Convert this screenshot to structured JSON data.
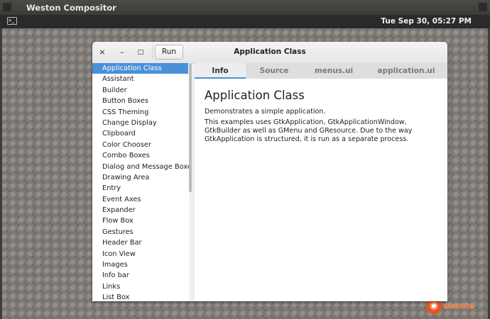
{
  "outer_window": {
    "title": "Weston Compositor"
  },
  "panel": {
    "terminal_icon_glyph": ">_",
    "clock": "Tue Sep 30, 05:27 PM"
  },
  "watermark": {
    "text": "ubuntu"
  },
  "app_window": {
    "title": "Application Class",
    "controls": {
      "close": "×",
      "minimize": "–",
      "maximize": "□"
    },
    "run_label": "Run"
  },
  "sidebar": {
    "selected_index": 0,
    "items": [
      "Application Class",
      "Assistant",
      "Builder",
      "Button Boxes",
      "CSS Theming",
      "Change Display",
      "Clipboard",
      "Color Chooser",
      "Combo Boxes",
      "Dialog and Message Boxes",
      "Drawing Area",
      "Entry",
      "Event Axes",
      "Expander",
      "Flow Box",
      "Gestures",
      "Header Bar",
      "Icon View",
      "Images",
      "Info bar",
      "Links",
      "List Box"
    ]
  },
  "tabs": [
    {
      "label": "Info",
      "active": true
    },
    {
      "label": "Source",
      "active": false
    },
    {
      "label": "menus.ui",
      "active": false
    },
    {
      "label": "application.ui",
      "active": false
    }
  ],
  "content": {
    "heading": "Application Class",
    "summary": "Demonstrates a simple application.",
    "description": "This examples uses GtkApplication, GtkApplicationWindow, GtkBuilder as well as GMenu and GResource. Due to the way GtkApplication is structured, it is run as a separate process."
  },
  "colors": {
    "accent": "#4a90d9",
    "watermark": "#e95420"
  }
}
